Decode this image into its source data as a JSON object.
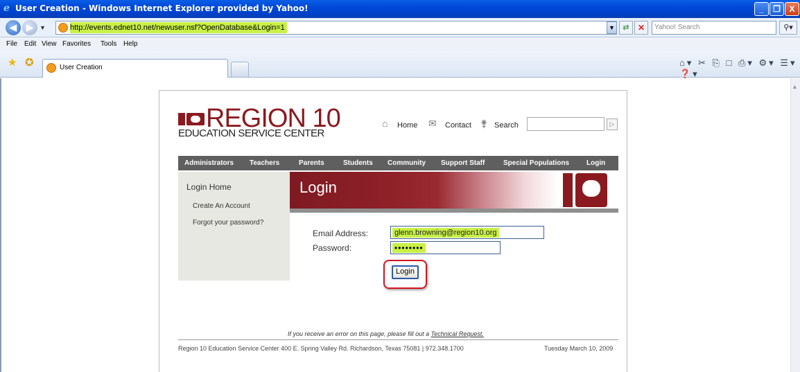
{
  "window": {
    "title": "User Creation - Windows Internet Explorer provided by Yahoo!",
    "minimize_glyph": "_",
    "maximize_glyph": "❐",
    "close_glyph": "X"
  },
  "addressbar": {
    "url": "http://events.ednet10.net/newuser.nsf?OpenDatabase&Login=1",
    "search_placeholder": "Yahoo! Search"
  },
  "menubar": {
    "items": [
      "File",
      "Edit",
      "View",
      "Favorites",
      "Tools",
      "Help"
    ]
  },
  "tabs": [
    {
      "label": "User Creation"
    }
  ],
  "site": {
    "logo_text": "REGION 10",
    "logo_sub": "EDUCATION SERVICE CENTER",
    "brand_color": "#8a1a1f",
    "top_links": [
      "Home",
      "Contact",
      "Search"
    ],
    "nav": [
      "Administrators",
      "Teachers",
      "Parents",
      "Students",
      "Community",
      "Support Staff",
      "Special Populations",
      "Login"
    ],
    "sidebar": {
      "heading": "Login Home",
      "items": [
        "Create An Account",
        "Forgot your password?"
      ]
    },
    "banner_title": "Login"
  },
  "form": {
    "email_label": "Email Address:",
    "email_value": "glenn.browning@region10.org",
    "password_label": "Password:",
    "password_value": "••••••••",
    "login_button": "Login"
  },
  "footer": {
    "error_note_prefix": "If you receive an error on this page, please fill out a ",
    "error_note_link": "Technical Request.",
    "address": "Region 10 Education Service Center 400 E. Spring Valley Rd. Richardson, Texas 75081 | 972.348.1700",
    "date": "Tuesday March 10, 2009"
  }
}
